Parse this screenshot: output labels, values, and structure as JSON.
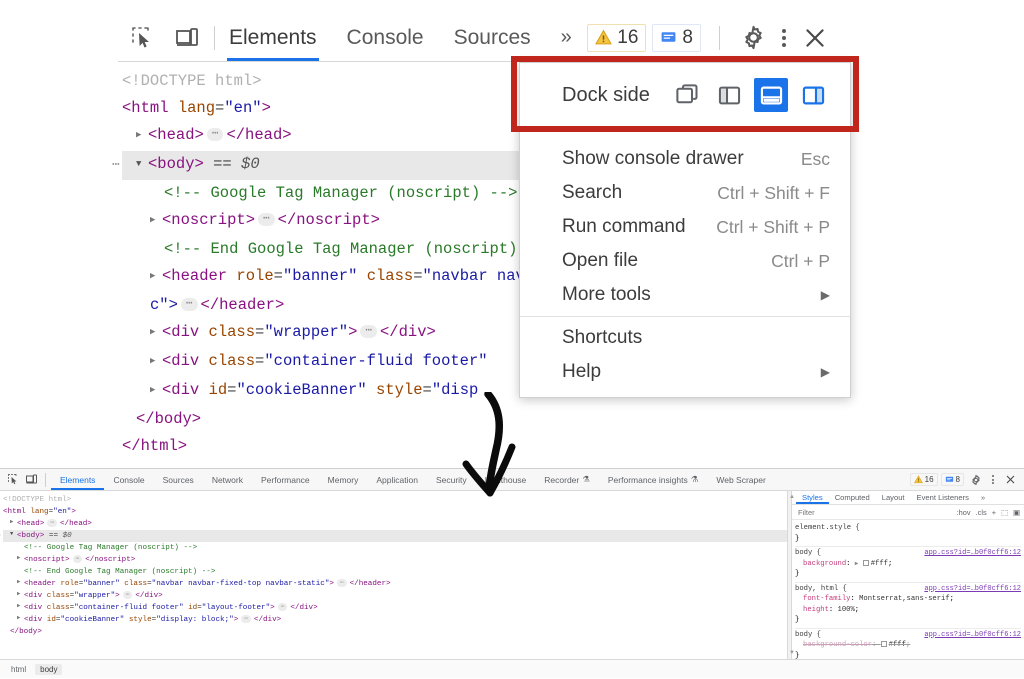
{
  "top_panel": {
    "icons": [
      {
        "name": "inspect-element-icon",
        "label": "Inspect element"
      },
      {
        "name": "device-toolbar-icon",
        "label": "Toggle device toolbar"
      }
    ],
    "tabs": [
      {
        "label": "Elements",
        "active": true
      },
      {
        "label": "Console",
        "active": false
      },
      {
        "label": "Sources",
        "active": false
      }
    ],
    "overflow_label": "»",
    "badges": {
      "warnings": "16",
      "messages": "8"
    },
    "settings_label": "Settings",
    "more_label": "Customize and control DevTools",
    "close_label": "Close DevTools",
    "code_lines": [
      {
        "indent": 0,
        "parts": [
          {
            "c": "t-doctype",
            "t": "<!DOCTYPE html>"
          }
        ]
      },
      {
        "indent": 0,
        "parts": [
          {
            "c": "t-tag",
            "t": "<html "
          },
          {
            "c": "t-attr",
            "t": "lang"
          },
          {
            "c": "t-plain",
            "t": "="
          },
          {
            "c": "t-val",
            "t": "\"en\""
          },
          {
            "c": "t-tag",
            "t": ">"
          }
        ]
      },
      {
        "indent": 1,
        "triangle": "closed",
        "parts": [
          {
            "c": "t-tag",
            "t": "<head>"
          },
          {
            "c": "dots",
            "t": "⋯"
          },
          {
            "c": "t-tag",
            "t": "</head>"
          }
        ]
      },
      {
        "indent": 1,
        "triangle": "open",
        "selected": true,
        "ellipsis": true,
        "parts": [
          {
            "c": "t-tag",
            "t": "<body>"
          },
          {
            "c": "t-plain",
            "t": " == "
          },
          {
            "c": "t-dollar",
            "t": "$0"
          }
        ]
      },
      {
        "indent": 3,
        "parts": [
          {
            "c": "t-com",
            "t": "<!-- Google Tag Manager (noscript) -->"
          }
        ]
      },
      {
        "indent": 2,
        "triangle": "closed",
        "parts": [
          {
            "c": "t-tag",
            "t": "<noscript>"
          },
          {
            "c": "dots",
            "t": "⋯"
          },
          {
            "c": "t-tag",
            "t": "</noscript>"
          }
        ]
      },
      {
        "indent": 3,
        "parts": [
          {
            "c": "t-com",
            "t": "<!-- End Google Tag Manager (noscript) -->"
          }
        ]
      },
      {
        "indent": 2,
        "triangle": "closed",
        "parts": [
          {
            "c": "t-tag",
            "t": "<header "
          },
          {
            "c": "t-attr",
            "t": "role"
          },
          {
            "c": "t-plain",
            "t": "="
          },
          {
            "c": "t-val",
            "t": "\"banner\""
          },
          {
            "c": "t-plain",
            "t": " "
          },
          {
            "c": "t-attr",
            "t": "class"
          },
          {
            "c": "t-plain",
            "t": "="
          },
          {
            "c": "t-val",
            "t": "\"navbar navbar-fixed-top navbar-static\""
          }
        ]
      },
      {
        "indent": 2,
        "parts": [
          {
            "c": "t-val",
            "t": "c\">"
          },
          {
            "c": "dots",
            "t": "⋯"
          },
          {
            "c": "t-tag",
            "t": "</header>"
          }
        ]
      },
      {
        "indent": 2,
        "triangle": "closed",
        "parts": [
          {
            "c": "t-tag",
            "t": "<div "
          },
          {
            "c": "t-attr",
            "t": "class"
          },
          {
            "c": "t-plain",
            "t": "="
          },
          {
            "c": "t-val",
            "t": "\"wrapper\""
          },
          {
            "c": "t-tag",
            "t": ">"
          },
          {
            "c": "dots",
            "t": "⋯"
          },
          {
            "c": "t-tag",
            "t": "</div>"
          }
        ]
      },
      {
        "indent": 2,
        "triangle": "closed",
        "parts": [
          {
            "c": "t-tag",
            "t": "<div "
          },
          {
            "c": "t-attr",
            "t": "class"
          },
          {
            "c": "t-plain",
            "t": "="
          },
          {
            "c": "t-val",
            "t": "\"container-fluid footer\""
          },
          {
            "c": "t-plain",
            "t": " "
          }
        ]
      },
      {
        "indent": 2,
        "triangle": "closed",
        "parts": [
          {
            "c": "t-tag",
            "t": "<div "
          },
          {
            "c": "t-attr",
            "t": "id"
          },
          {
            "c": "t-plain",
            "t": "="
          },
          {
            "c": "t-val",
            "t": "\"cookieBanner\""
          },
          {
            "c": "t-plain",
            "t": " "
          },
          {
            "c": "t-attr",
            "t": "style"
          },
          {
            "c": "t-plain",
            "t": "="
          },
          {
            "c": "t-val",
            "t": "\"disp"
          }
        ]
      },
      {
        "indent": 1,
        "parts": [
          {
            "c": "t-tag",
            "t": "</body>"
          }
        ]
      },
      {
        "indent": 0,
        "parts": [
          {
            "c": "t-tag",
            "t": "</html>"
          }
        ]
      }
    ]
  },
  "context_menu": {
    "dock_side": {
      "label": "Dock side",
      "options": [
        {
          "name": "undock-into-separate-window-icon",
          "selected": false
        },
        {
          "name": "dock-to-left-icon",
          "selected": false
        },
        {
          "name": "dock-to-bottom-icon",
          "selected": true
        },
        {
          "name": "dock-to-right-icon",
          "selected": false
        }
      ]
    },
    "items": [
      {
        "label": "Show console drawer",
        "shortcut": "Esc",
        "submenu": false
      },
      {
        "label": "Search",
        "shortcut": "Ctrl + Shift + F",
        "submenu": false
      },
      {
        "label": "Run command",
        "shortcut": "Ctrl + Shift + P",
        "submenu": false
      },
      {
        "label": "Open file",
        "shortcut": "Ctrl + P",
        "submenu": false
      },
      {
        "label": "More tools",
        "shortcut": "",
        "submenu": true
      }
    ],
    "items2": [
      {
        "label": "Shortcuts",
        "shortcut": "",
        "submenu": false
      },
      {
        "label": "Help",
        "shortcut": "",
        "submenu": true
      }
    ]
  },
  "annotation": {
    "highlight_color": "#c0261c",
    "arrow_name": "hand-drawn-down-arrow"
  },
  "bottom_panel": {
    "icons": [
      {
        "name": "inspect-element-icon"
      },
      {
        "name": "device-toolbar-icon"
      }
    ],
    "tabs": [
      {
        "label": "Elements",
        "active": true,
        "badge": ""
      },
      {
        "label": "Console",
        "active": false,
        "badge": ""
      },
      {
        "label": "Sources",
        "active": false,
        "badge": ""
      },
      {
        "label": "Network",
        "active": false,
        "badge": ""
      },
      {
        "label": "Performance",
        "active": false,
        "badge": ""
      },
      {
        "label": "Memory",
        "active": false,
        "badge": ""
      },
      {
        "label": "Application",
        "active": false,
        "badge": ""
      },
      {
        "label": "Security",
        "active": false,
        "badge": ""
      },
      {
        "label": "Lighthouse",
        "active": false,
        "badge": ""
      },
      {
        "label": "Recorder",
        "active": false,
        "badge": "⚗"
      },
      {
        "label": "Performance insights",
        "active": false,
        "badge": "⚗"
      },
      {
        "label": "Web Scraper",
        "active": false,
        "badge": ""
      }
    ],
    "badges": {
      "warnings": "16",
      "messages": "8"
    },
    "dom_lines": [
      {
        "indent": 0,
        "parts": [
          {
            "c": "t-doctype",
            "t": "<!DOCTYPE html>"
          }
        ]
      },
      {
        "indent": 0,
        "parts": [
          {
            "c": "t-tag",
            "t": "<html "
          },
          {
            "c": "t-attr",
            "t": "lang"
          },
          {
            "c": "t-plain",
            "t": "="
          },
          {
            "c": "t-val",
            "t": "\"en\""
          },
          {
            "c": "t-tag",
            "t": ">"
          }
        ]
      },
      {
        "indent": 1,
        "triangle": "closed",
        "parts": [
          {
            "c": "t-tag",
            "t": "<head>"
          },
          {
            "c": "dots",
            "t": "⋯"
          },
          {
            "c": "t-tag",
            "t": "</head>"
          }
        ]
      },
      {
        "indent": 1,
        "triangle": "open",
        "selected": true,
        "ellipsis": true,
        "parts": [
          {
            "c": "t-tag",
            "t": "<body>"
          },
          {
            "c": "t-plain",
            "t": " == "
          },
          {
            "c": "t-dollar",
            "t": "$0"
          }
        ]
      },
      {
        "indent": 3,
        "parts": [
          {
            "c": "t-com",
            "t": "<!-- Google Tag Manager (noscript) -->"
          }
        ]
      },
      {
        "indent": 2,
        "triangle": "closed",
        "parts": [
          {
            "c": "t-tag",
            "t": "<noscript>"
          },
          {
            "c": "dots",
            "t": "⋯"
          },
          {
            "c": "t-tag",
            "t": "</noscript>"
          }
        ]
      },
      {
        "indent": 3,
        "parts": [
          {
            "c": "t-com",
            "t": "<!-- End Google Tag Manager (noscript) -->"
          }
        ]
      },
      {
        "indent": 2,
        "triangle": "closed",
        "parts": [
          {
            "c": "t-tag",
            "t": "<header "
          },
          {
            "c": "t-attr",
            "t": "role"
          },
          {
            "c": "t-plain",
            "t": "="
          },
          {
            "c": "t-val",
            "t": "\"banner\""
          },
          {
            "c": "t-plain",
            "t": " "
          },
          {
            "c": "t-attr",
            "t": "class"
          },
          {
            "c": "t-plain",
            "t": "="
          },
          {
            "c": "t-val",
            "t": "\"navbar navbar-fixed-top navbar-static\""
          },
          {
            "c": "t-tag",
            "t": ">"
          },
          {
            "c": "dots",
            "t": "⋯"
          },
          {
            "c": "t-tag",
            "t": "</header>"
          }
        ]
      },
      {
        "indent": 2,
        "triangle": "closed",
        "parts": [
          {
            "c": "t-tag",
            "t": "<div "
          },
          {
            "c": "t-attr",
            "t": "class"
          },
          {
            "c": "t-plain",
            "t": "="
          },
          {
            "c": "t-val",
            "t": "\"wrapper\""
          },
          {
            "c": "t-tag",
            "t": ">"
          },
          {
            "c": "dots",
            "t": "⋯"
          },
          {
            "c": "t-tag",
            "t": "</div>"
          }
        ]
      },
      {
        "indent": 2,
        "triangle": "closed",
        "parts": [
          {
            "c": "t-tag",
            "t": "<div "
          },
          {
            "c": "t-attr",
            "t": "class"
          },
          {
            "c": "t-plain",
            "t": "="
          },
          {
            "c": "t-val",
            "t": "\"container-fluid footer\""
          },
          {
            "c": "t-plain",
            "t": " "
          },
          {
            "c": "t-attr",
            "t": "id"
          },
          {
            "c": "t-plain",
            "t": "="
          },
          {
            "c": "t-val",
            "t": "\"layout-footer\""
          },
          {
            "c": "t-tag",
            "t": ">"
          },
          {
            "c": "dots",
            "t": "⋯"
          },
          {
            "c": "t-tag",
            "t": "</div>"
          }
        ]
      },
      {
        "indent": 2,
        "triangle": "closed",
        "parts": [
          {
            "c": "t-tag",
            "t": "<div "
          },
          {
            "c": "t-attr",
            "t": "id"
          },
          {
            "c": "t-plain",
            "t": "="
          },
          {
            "c": "t-val",
            "t": "\"cookieBanner\""
          },
          {
            "c": "t-plain",
            "t": " "
          },
          {
            "c": "t-attr",
            "t": "style"
          },
          {
            "c": "t-plain",
            "t": "="
          },
          {
            "c": "t-val",
            "t": "\"display: block;\""
          },
          {
            "c": "t-tag",
            "t": ">"
          },
          {
            "c": "dots",
            "t": "⋯"
          },
          {
            "c": "t-tag",
            "t": "</div>"
          }
        ]
      },
      {
        "indent": 1,
        "parts": [
          {
            "c": "t-tag",
            "t": "</body>"
          }
        ]
      }
    ],
    "styles": {
      "tabs": [
        {
          "label": "Styles",
          "active": true
        },
        {
          "label": "Computed",
          "active": false
        },
        {
          "label": "Layout",
          "active": false
        },
        {
          "label": "Event Listeners",
          "active": false
        }
      ],
      "overflow_label": "»",
      "filter_placeholder": "Filter",
      "tools": [
        ":hov",
        ".cls",
        "+",
        "⬚",
        "▣"
      ],
      "rules": [
        {
          "selector": "element.style",
          "source": "",
          "props": []
        },
        {
          "selector": "body",
          "source": "app.css?id=…b0f0cff6:12",
          "props": [
            {
              "name": "background",
              "value": "#fff",
              "swatch": true,
              "expand": true,
              "struck": false
            }
          ]
        },
        {
          "selector": "body, html",
          "source": "app.css?id=…b0f0cff6:12",
          "props": [
            {
              "name": "font-family",
              "value": "Montserrat,sans-serif",
              "swatch": false,
              "expand": false,
              "struck": false
            },
            {
              "name": "height",
              "value": "100%",
              "swatch": false,
              "expand": false,
              "struck": false
            }
          ]
        },
        {
          "selector": "body",
          "source": "app.css?id=…b0f0cff6:12",
          "props": [
            {
              "name": "background-color",
              "value": "#fff",
              "swatch": true,
              "expand": false,
              "struck": true
            }
          ]
        }
      ]
    },
    "breadcrumb": [
      {
        "label": "html",
        "active": false
      },
      {
        "label": "body",
        "active": true
      }
    ]
  }
}
